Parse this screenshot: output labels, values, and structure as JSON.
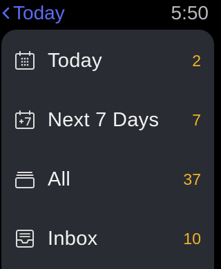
{
  "colors": {
    "accent": "#5b6cf5",
    "count": "#f0b429",
    "background": "#000000",
    "card": "#2a2c33",
    "label": "#f2f2f2",
    "clock": "#b8b8bc"
  },
  "header": {
    "back_label": "Today",
    "back_icon": "chevron-left-icon",
    "time": "5:50"
  },
  "lists": [
    {
      "icon": "calendar-grid-icon",
      "label": "Today",
      "count": "2"
    },
    {
      "icon": "calendar-plus-seven-icon",
      "label": "Next 7 Days",
      "count": "7"
    },
    {
      "icon": "stacked-tray-icon",
      "label": "All",
      "count": "37"
    },
    {
      "icon": "inbox-icon",
      "label": "Inbox",
      "count": "10"
    }
  ]
}
